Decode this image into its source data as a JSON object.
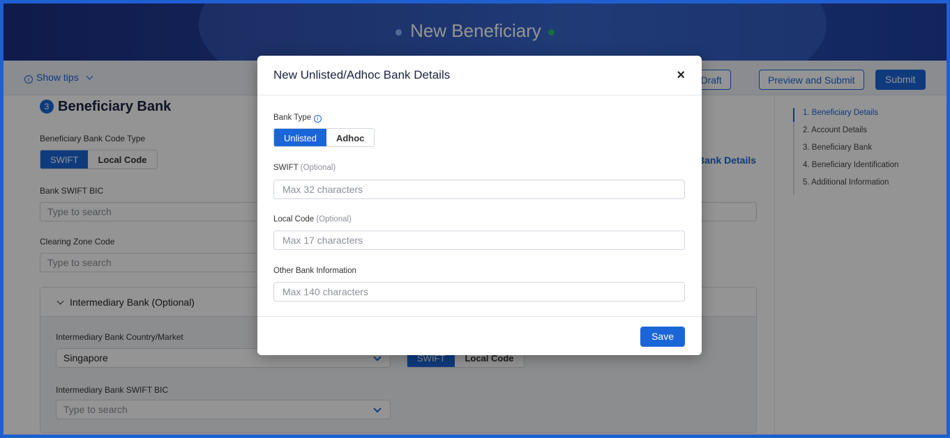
{
  "header": {
    "title": "New Beneficiary"
  },
  "toolbar": {
    "show_tips": "Show tips",
    "save_draft": "ave Draft",
    "preview_submit": "Preview and Submit",
    "submit": "Submit"
  },
  "section": {
    "number": "3",
    "title": "Beneficiary Bank",
    "code_type_label": "Beneficiary Bank Code Type",
    "code_type_options": [
      "SWIFT",
      "Local Code"
    ],
    "code_type_selected": "SWIFT",
    "swift_bic_label": "Bank SWIFT BIC",
    "swift_bic_placeholder": "Type to search",
    "clearing_zone_label": "Clearing Zone Code",
    "clearing_zone_placeholder": "Type to search",
    "bank_details_link": "Bank Details"
  },
  "intermediary": {
    "header": "Intermediary Bank (Optional)",
    "country_label": "Intermediary Bank Country/Market",
    "country_value": "Singapore",
    "code_options": [
      "SWIFT",
      "Local Code"
    ],
    "swift_label": "Intermediary Bank SWIFT BIC",
    "swift_placeholder": "Type to search"
  },
  "stepper": {
    "steps": [
      "1. Beneficiary Details",
      "2. Account Details",
      "3. Beneficiary Bank",
      "4. Beneficiary Identification",
      "5. Additional Information"
    ],
    "active_index": 0
  },
  "modal": {
    "title": "New Unlisted/Adhoc Bank Details",
    "close": "×",
    "bank_type_label": "Bank Type",
    "bank_type_options": [
      "Unlisted",
      "Adhoc"
    ],
    "bank_type_selected": "Unlisted",
    "swift_label": "SWIFT",
    "swift_optional": "(Optional)",
    "swift_placeholder": "Max 32 characters",
    "local_code_label": "Local Code",
    "local_code_optional": "(Optional)",
    "local_code_placeholder": "Max 17 characters",
    "other_info_label": "Other Bank Information",
    "other_info_placeholder": "Max 140 characters",
    "save": "Save"
  },
  "colors": {
    "primary": "#1a66d8",
    "header_bg": "#23409c",
    "accent_green": "#22c06b"
  }
}
